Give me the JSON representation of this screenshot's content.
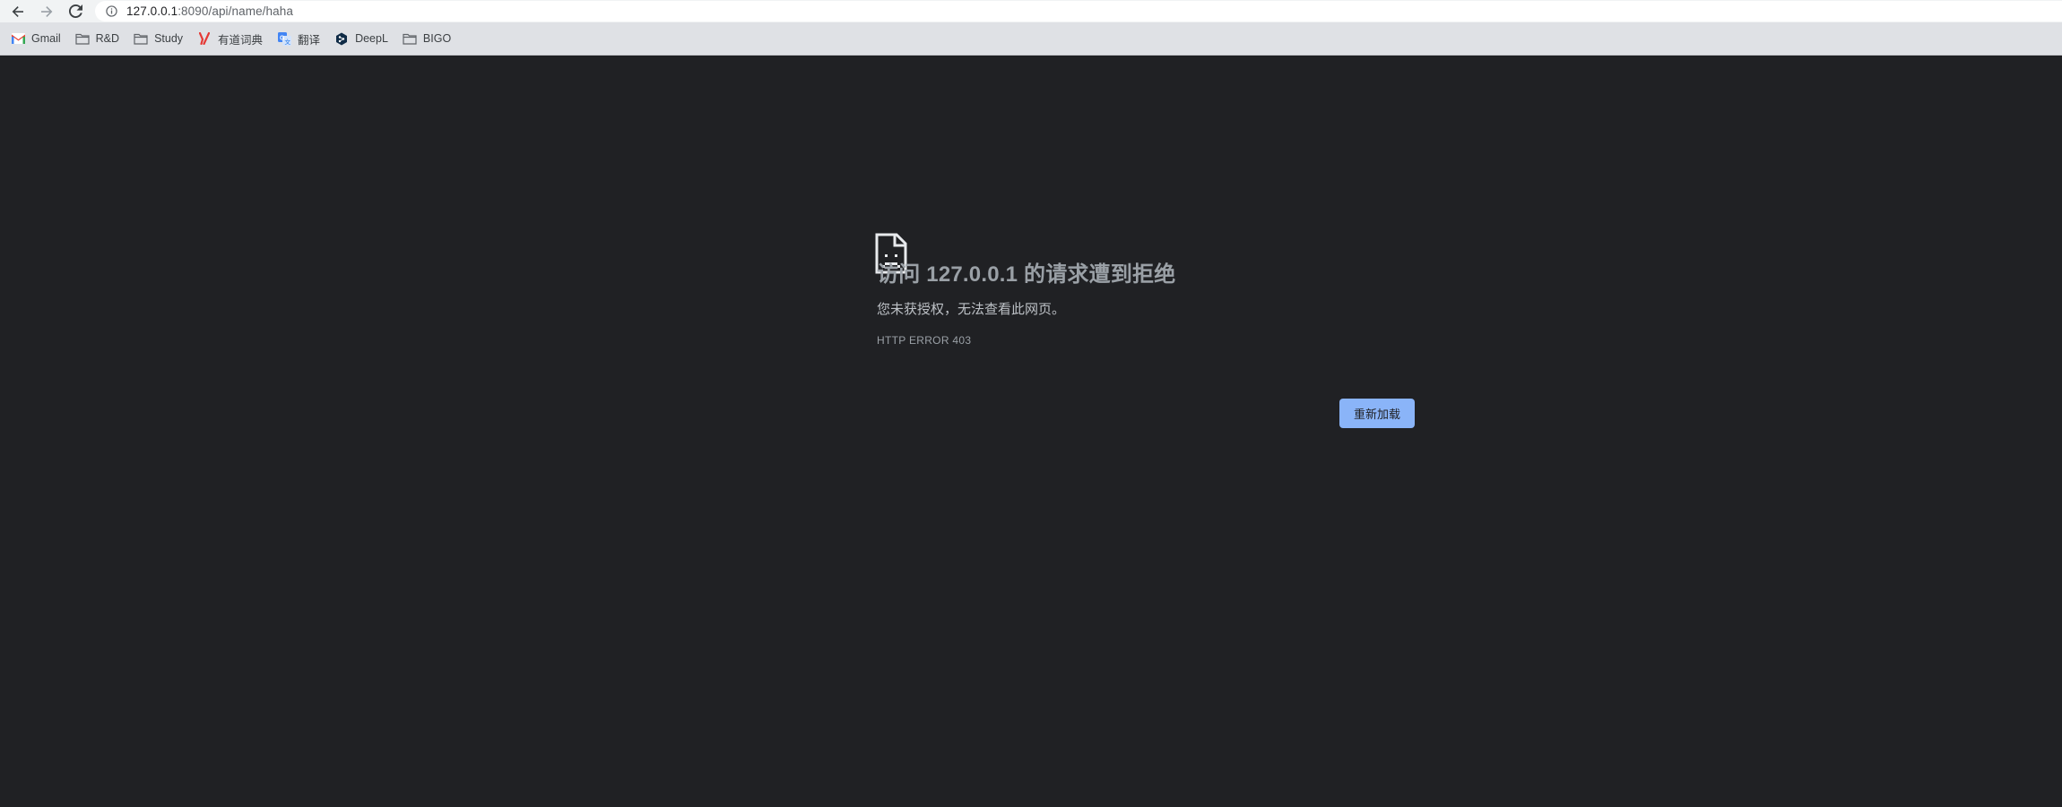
{
  "toolbar": {
    "url_host": "127.0.0.1",
    "url_rest": ":8090/api/name/haha",
    "icons": [
      "back-arrow-icon",
      "forward-arrow-icon",
      "reload-icon",
      "info-icon"
    ]
  },
  "bookmarks": [
    {
      "label": "Gmail",
      "icon": "gmail-icon"
    },
    {
      "label": "R&D",
      "icon": "folder-icon"
    },
    {
      "label": "Study",
      "icon": "folder-icon"
    },
    {
      "label": "有道词典",
      "icon": "youdao-icon"
    },
    {
      "label": "翻译",
      "icon": "translate-icon"
    },
    {
      "label": "DeepL",
      "icon": "deepl-icon"
    },
    {
      "label": "BIGO",
      "icon": "folder-icon"
    }
  ],
  "error": {
    "icon": "sad-document-icon",
    "title": "访问 127.0.0.1 的请求遭到拒绝",
    "description": "您未获授权，无法查看此网页。",
    "code": "HTTP ERROR 403",
    "reload_label": "重新加载"
  },
  "colors": {
    "page_bg": "#202124",
    "toolbar_bg": "#f1f3f4",
    "bookmarks_bg": "#dfe1e5",
    "title_text": "#9aa0a6",
    "desc_text": "#bdc1c6",
    "button_bg": "#8ab4f8"
  }
}
